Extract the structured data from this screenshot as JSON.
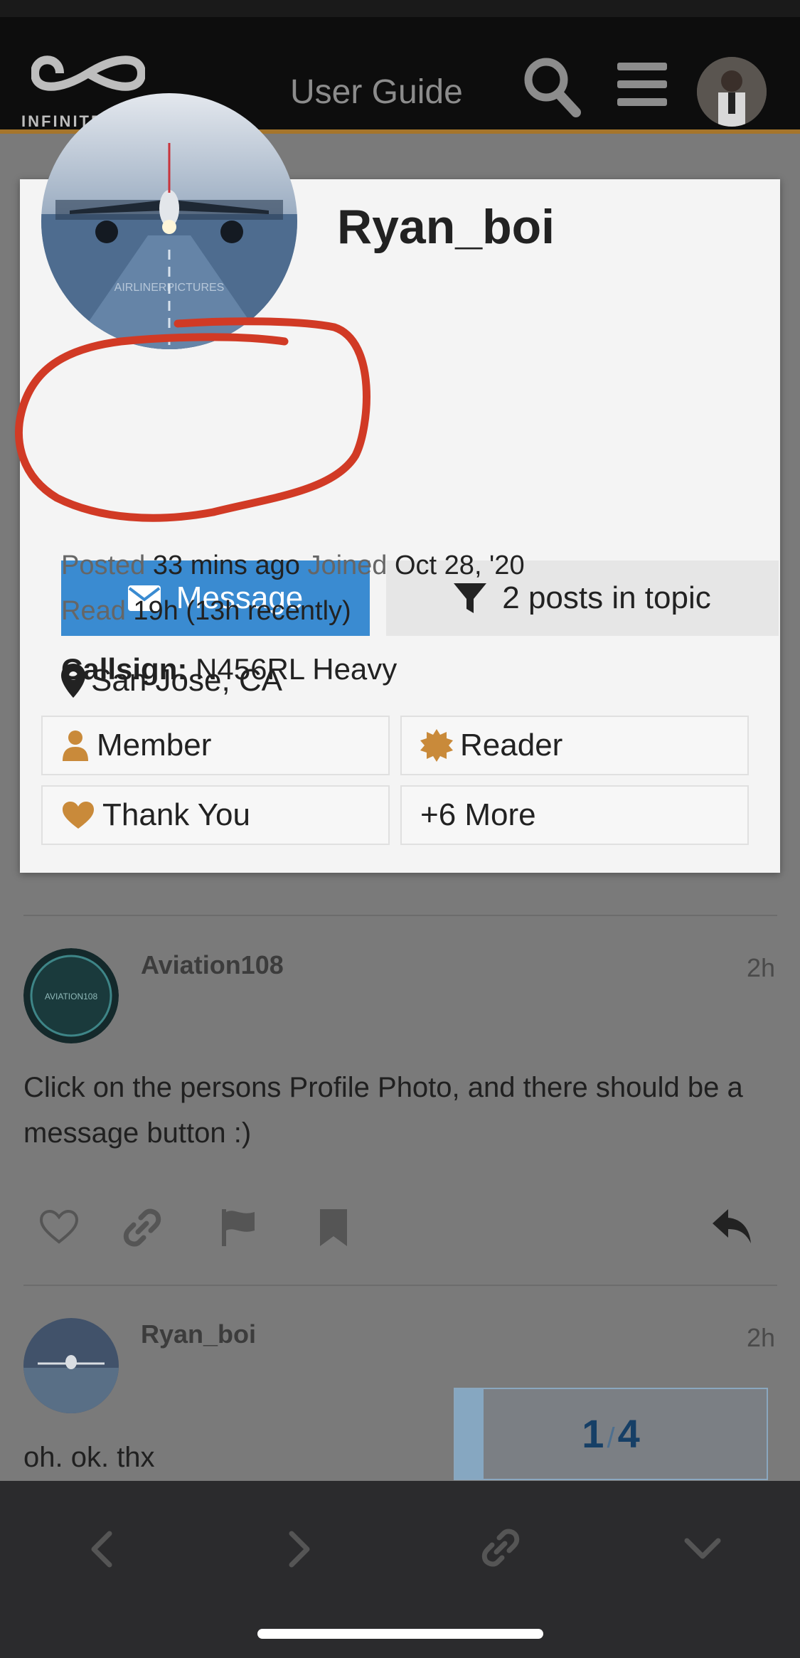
{
  "header": {
    "logo_text_main": "INFINITE FL",
    "logo_text_accent": "I",
    "title": "User Guide",
    "search_icon": "search-icon",
    "menu_icon": "hamburger-menu-icon"
  },
  "user_card": {
    "username": "Ryan_boi",
    "avatar_watermark": "AIRLINERPICTURES",
    "message_button": "Message",
    "posts_button": "2 posts in topic",
    "location": "San Jose, CA",
    "posted_label": "Posted",
    "posted_value": "33 mins ago",
    "joined_label": "Joined",
    "joined_value": "Oct 28, '20",
    "read_label": "Read",
    "read_value": "19h (13h recently)",
    "callsign_label": "Callsign:",
    "callsign_value": "N456RL Heavy",
    "badges": [
      {
        "label": "Member",
        "icon": "user-icon"
      },
      {
        "label": "Reader",
        "icon": "certificate-icon"
      },
      {
        "label": "Thank You",
        "icon": "heart-icon"
      },
      {
        "label": "+6 More",
        "icon": ""
      }
    ]
  },
  "posts": [
    {
      "author": "Aviation108",
      "avatar_text": "AVIATION108",
      "time": "2h",
      "body": "Click on the persons Profile Photo, and there should be a message button :)"
    },
    {
      "author": "Ryan_boi",
      "time": "2h",
      "body": "oh. ok. thx"
    }
  ],
  "progress": {
    "current": "1",
    "separator": "/",
    "total": "4"
  },
  "toolbar": [
    "back-icon",
    "forward-icon",
    "share-link-icon",
    "collapse-icon"
  ],
  "colors": {
    "accent": "#3a8bd1",
    "header_bar": "#a5752b",
    "badge_gold": "#c98a3a",
    "annotation": "#d13a25"
  }
}
